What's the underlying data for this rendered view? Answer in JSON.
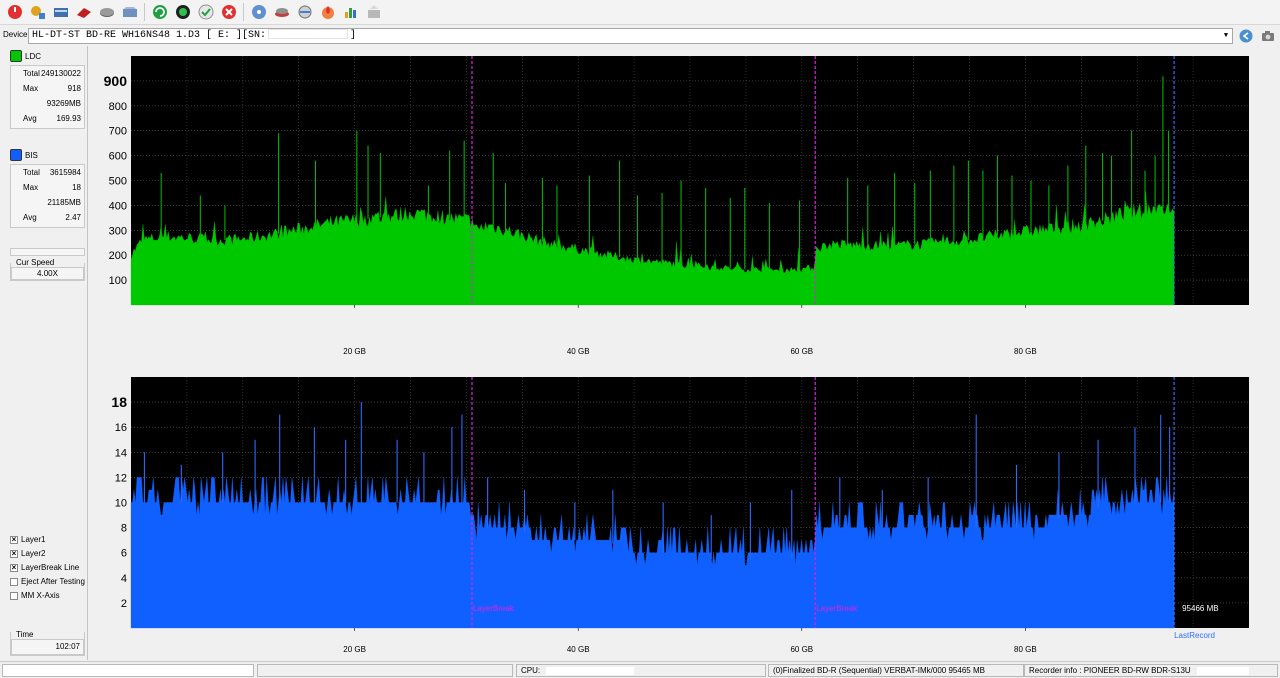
{
  "toolbar": {
    "icons": [
      "power-icon",
      "wizard-icon",
      "drive-info-icon",
      "erase-icon",
      "disc-icon",
      "write-icon",
      "refresh-icon",
      "globe-icon",
      "check-icon",
      "stop-icon",
      "disc-blue-icon",
      "tray-icon",
      "scan-icon",
      "burn-icon",
      "chart-icon",
      "eject-icon"
    ]
  },
  "device": {
    "label": "Device:",
    "value_prefix": "HL-DT-ST BD-RE  WH16NS48  1.D3 [ E: ][SN:",
    "value_suffix": "]"
  },
  "ldc": {
    "label": "LDC",
    "color": "#00c800",
    "total_label": "Total",
    "total": "249130022",
    "max_label": "Max",
    "max": "918",
    "max_pos": "93269MB",
    "avg_label": "Avg",
    "avg": "169.93"
  },
  "bis": {
    "label": "BIS",
    "color": "#1060ff",
    "total_label": "Total",
    "total": "3615984",
    "max_label": "Max",
    "max": "18",
    "max_pos": "21185MB",
    "avg_label": "Avg",
    "avg": "2.47"
  },
  "speed": {
    "label": "Cur Speed",
    "value": "4.00X"
  },
  "options": [
    {
      "label": "Layer1",
      "checked": true
    },
    {
      "label": "Layer2",
      "checked": true
    },
    {
      "label": "LayerBreak Line",
      "checked": true
    },
    {
      "label": "Eject After Testing",
      "checked": false
    },
    {
      "label": "MM X-Axis",
      "checked": false
    }
  ],
  "time": {
    "label": "Time",
    "value": "102:07"
  },
  "chart_data": [
    {
      "type": "area",
      "name": "LDC",
      "color": "#00c800",
      "x_unit": "GB",
      "xlim": [
        0,
        100
      ],
      "ylim": [
        0,
        1000
      ],
      "ytick_labels": [
        "100",
        "200",
        "300",
        "400",
        "500",
        "600",
        "700",
        "800",
        "900"
      ],
      "ytick_values": [
        100,
        200,
        300,
        400,
        500,
        600,
        700,
        800,
        900
      ],
      "xtick_labels": [
        "20 GB",
        "40 GB",
        "60 GB",
        "80 GB"
      ],
      "xtick_values": [
        20,
        40,
        60,
        80
      ],
      "layer_breaks": [
        30.5,
        61.2
      ],
      "last_record": 93.3,
      "baseline_x": [
        0,
        1,
        3,
        5,
        8,
        10,
        13,
        15,
        18,
        20,
        23,
        25,
        27,
        29,
        30.4,
        30.6,
        32,
        34,
        36,
        38,
        40,
        42,
        44,
        46,
        48,
        50,
        52,
        54,
        56,
        58,
        60,
        61.1,
        61.3,
        63,
        65,
        67,
        69,
        71,
        73,
        75,
        77,
        79,
        81,
        83,
        85,
        87,
        89,
        91,
        93.2
      ],
      "baseline_y": [
        200,
        260,
        275,
        270,
        260,
        265,
        285,
        305,
        330,
        340,
        355,
        370,
        360,
        345,
        340,
        300,
        320,
        295,
        265,
        240,
        225,
        205,
        190,
        178,
        168,
        160,
        152,
        146,
        142,
        140,
        145,
        150,
        230,
        245,
        240,
        238,
        240,
        245,
        255,
        262,
        275,
        290,
        300,
        310,
        320,
        340,
        370,
        380,
        395
      ],
      "spikes_x": [
        2.7,
        6.2,
        8.4,
        13.2,
        16.5,
        20.2,
        21.2,
        22.3,
        26.6,
        28.5,
        29.8,
        32.4,
        33.5,
        36.8,
        38.1,
        41.0,
        43.7,
        45.3,
        47.5,
        49.2,
        51.4,
        53.6,
        54.9,
        57.1,
        59.8,
        64.1,
        65.9,
        68.3,
        70.1,
        71.5,
        73.6,
        74.9,
        76.2,
        77.5,
        78.8,
        80.5,
        82.1,
        83.8,
        85.4,
        86.9,
        87.7,
        89.5,
        90.7,
        91.6,
        92.3,
        92.8
      ],
      "spikes_y": [
        530,
        440,
        400,
        690,
        580,
        700,
        640,
        610,
        480,
        620,
        660,
        610,
        490,
        510,
        480,
        520,
        580,
        440,
        450,
        500,
        470,
        430,
        470,
        410,
        420,
        510,
        480,
        530,
        490,
        540,
        560,
        580,
        540,
        600,
        520,
        500,
        480,
        560,
        640,
        610,
        600,
        700,
        540,
        600,
        918,
        700
      ]
    },
    {
      "type": "area",
      "name": "BIS",
      "color": "#1060ff",
      "x_unit": "GB",
      "xlim": [
        0,
        100
      ],
      "ylim": [
        0,
        20
      ],
      "ytick_labels": [
        "2",
        "4",
        "6",
        "8",
        "10",
        "12",
        "14",
        "16",
        "18"
      ],
      "ytick_values": [
        2,
        4,
        6,
        8,
        10,
        12,
        14,
        16,
        18
      ],
      "xtick_labels": [
        "20 GB",
        "40 GB",
        "60 GB",
        "80 GB"
      ],
      "xtick_values": [
        20,
        40,
        60,
        80
      ],
      "layer_breaks": [
        30.5,
        61.2
      ],
      "last_record": 93.3,
      "layer_break_label": "LayerBreak",
      "last_record_label": "LastRecord",
      "end_label": "95466 MB",
      "baseline_x": [
        0,
        5,
        10,
        15,
        20,
        25,
        30.4,
        30.6,
        34,
        38,
        42,
        46,
        48,
        52,
        56,
        60,
        61.1,
        61.3,
        64,
        68,
        72,
        76,
        80,
        84,
        88,
        93.2
      ],
      "baseline_y": [
        10,
        10,
        10,
        10,
        10,
        10,
        10,
        8,
        8,
        7,
        7,
        6,
        6,
        5.5,
        5.5,
        5.5,
        6,
        8,
        8,
        8,
        8,
        8,
        8,
        9,
        10,
        10
      ],
      "spikes_x": [
        1.2,
        4.5,
        8.2,
        11.1,
        13.3,
        16.4,
        19.2,
        20.6,
        23.8,
        26.2,
        28.7,
        29.6,
        31.9,
        35.2,
        39.7,
        43.1,
        47.6,
        51.9,
        55.4,
        59.1,
        63.4,
        67.2,
        71.3,
        75.6,
        79.2,
        83.0,
        86.5,
        89.8,
        92.1,
        92.9
      ],
      "spikes_y": [
        14,
        13,
        14,
        15,
        17,
        16,
        15,
        18,
        15,
        14,
        16,
        17,
        12,
        11,
        10,
        11,
        10,
        9,
        10,
        11,
        12,
        11,
        12,
        17,
        13,
        14,
        15,
        16,
        17,
        16
      ]
    }
  ],
  "status": {
    "cpu_label": "CPU:",
    "disc": "(0)Finalized  BD-R (Sequential)  VERBAT-IMk/000   95465 MB",
    "recorder": "Recorder info : PIONEER      BD-RW   BDR-S13U"
  }
}
